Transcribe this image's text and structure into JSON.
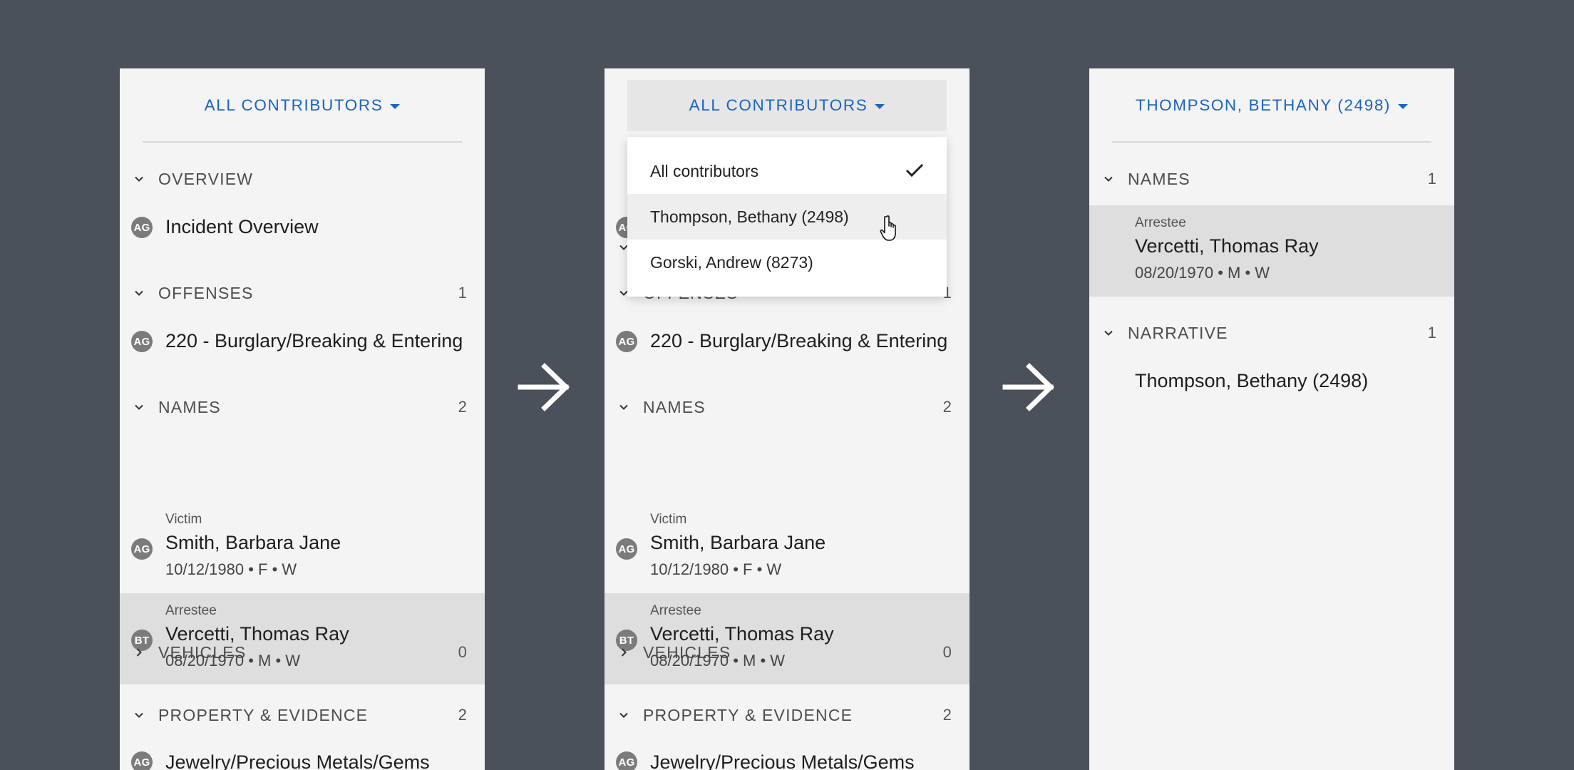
{
  "panel1": {
    "contributor_label": "ALL CONTRIBUTORS",
    "sections": {
      "overview": {
        "title": "OVERVIEW",
        "count": ""
      },
      "offenses": {
        "title": "OFFENSES",
        "count": "1"
      },
      "names": {
        "title": "NAMES",
        "count": "2"
      },
      "vehicles": {
        "title": "VEHICLES",
        "count": "0"
      },
      "property": {
        "title": "PROPERTY & EVIDENCE",
        "count": "2"
      }
    },
    "overview_item": {
      "badge": "AG",
      "title": "Incident Overview"
    },
    "offense_item": {
      "badge": "AG",
      "title": "220 - Burglary/Breaking & Entering"
    },
    "names_items": [
      {
        "badge": "AG",
        "role": "Victim",
        "name": "Smith, Barbara Jane",
        "meta": "10/12/1980 • F • W"
      },
      {
        "badge": "BT",
        "role": "Arrestee",
        "name": "Vercetti, Thomas Ray",
        "meta": "08/20/1970 • M • W"
      }
    ],
    "property_item": {
      "badge": "AG",
      "title": "Jewelry/Precious Metals/Gems"
    }
  },
  "panel2": {
    "contributor_label": "ALL CONTRIBUTORS",
    "sections": {
      "offenses": {
        "title": "OFFENSES",
        "count": "1"
      },
      "names": {
        "title": "NAMES",
        "count": "2"
      },
      "vehicles": {
        "title": "VEHICLES",
        "count": "0"
      },
      "property": {
        "title": "PROPERTY & EVIDENCE",
        "count": "2"
      }
    },
    "offense_item": {
      "badge": "AG",
      "title": "220 - Burglary/Breaking & Entering"
    },
    "names_items": [
      {
        "badge": "AG",
        "role": "Victim",
        "name": "Smith, Barbara Jane",
        "meta": "10/12/1980 • F • W"
      },
      {
        "badge": "BT",
        "role": "Arrestee",
        "name": "Vercetti, Thomas Ray",
        "meta": "08/20/1970 • M • W"
      }
    ],
    "property_item": {
      "badge": "AG",
      "title": "Jewelry/Precious Metals/Gems"
    },
    "hidden_overview_badge": "AG",
    "dropdown": {
      "options": [
        "All contributors",
        "Thompson, Bethany (2498)",
        "Gorski, Andrew (8273)"
      ],
      "selected": "All contributors",
      "hovered": "Thompson, Bethany (2498)"
    }
  },
  "panel3": {
    "contributor_label": "THOMPSON, BETHANY (2498)",
    "sections": {
      "names": {
        "title": "NAMES",
        "count": "1"
      },
      "narrative": {
        "title": "NARRATIVE",
        "count": "1"
      }
    },
    "names_items": [
      {
        "role": "Arrestee",
        "name": "Vercetti, Thomas Ray",
        "meta": "08/20/1970 • M • W"
      }
    ],
    "narrative_item": {
      "title": "Thompson, Bethany (2498)"
    }
  },
  "icons": {
    "chevron_down": "chevron-down-icon",
    "chevron_right": "chevron-right-icon",
    "caret": "caret-down-icon",
    "arrow": "arrow-right-icon",
    "check": "check-icon",
    "cursor": "hand-pointer-icon"
  },
  "colors": {
    "background": "#4b515a",
    "panel": "#f4f4f4",
    "accent": "#1a64c4",
    "selected_row": "#dedede",
    "badge": "#7b7b7b"
  }
}
